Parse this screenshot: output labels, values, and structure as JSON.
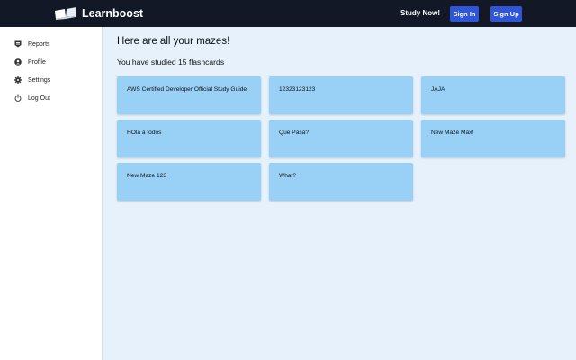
{
  "header": {
    "brand": "Learnboost",
    "study_now": "Study Now!",
    "sign_in": "Sign In",
    "sign_up": "Sign Up"
  },
  "sidebar": {
    "items": [
      {
        "label": "Reports",
        "icon": "reports-icon"
      },
      {
        "label": "Profile",
        "icon": "profile-icon"
      },
      {
        "label": "Settings",
        "icon": "gear-icon"
      },
      {
        "label": "Log Out",
        "icon": "power-icon"
      }
    ]
  },
  "main": {
    "title": "Here are all your mazes!",
    "subtitle": "You have studied 15 flashcards",
    "mazes": [
      "AWS Certified Developer Official Study Guide",
      "12323123123",
      "JAJA",
      "HOla a todos",
      "Que Pasa?",
      "New Maze Max!",
      "New Maze 123",
      "What?"
    ]
  },
  "colors": {
    "topbar": "#121826",
    "button": "#2f56d6",
    "card": "#99d0f6",
    "background": "#e6f1fc"
  }
}
